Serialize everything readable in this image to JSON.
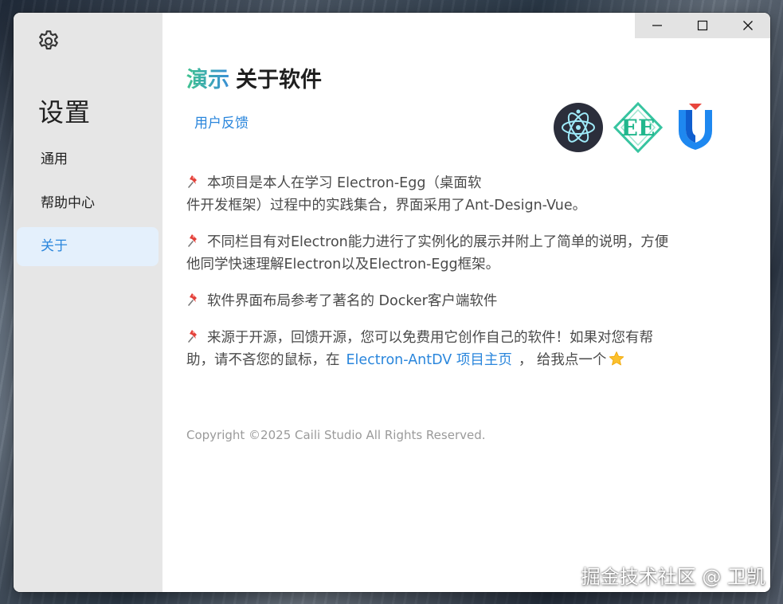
{
  "sidebar": {
    "title": "设置",
    "items": [
      {
        "label": "通用",
        "active": false
      },
      {
        "label": "帮助中心",
        "active": false
      },
      {
        "label": "关于",
        "active": true
      }
    ]
  },
  "page": {
    "title_accent": "演示",
    "title": "关于软件",
    "feedback_link": "用户反馈"
  },
  "content": {
    "p1_line1": "本项目是本人在学习 Electron-Egg（桌面软",
    "p1_line2": "件开发框架）过程中的实践集合，界面采用了Ant-Design-Vue。",
    "p2_line1": "不同栏目有对Electron能力进行了实例化的展示并附上了简单的说明，方便",
    "p2_line2": "他同学快速理解Electron以及Electron-Egg框架。",
    "p3": "软件界面布局参考了著名的 Docker客户端软件",
    "p4_line1": "来源于开源，回馈开源，您可以免费用它创作自己的软件！如果对您有帮",
    "p4_line2_prefix": "助，请不吝您的鼠标，在",
    "p4_link": "Electron-AntDV 项目主页",
    "p4_line2_suffix": "， 给我点一个"
  },
  "copyright": "Copyright ©2025 Caili Studio All Rights Reserved.",
  "watermark": "掘金技术社区 @ 卫凯",
  "icons": {
    "settings": "gear-icon",
    "minimize": "minimize-icon",
    "maximize": "maximize-icon",
    "close": "close-icon",
    "bullet": "pushpin-icon",
    "star": "star-icon",
    "logos": [
      "electron-logo",
      "electron-egg-logo",
      "antdv-logo"
    ]
  },
  "colors": {
    "accent": "#2a86dc",
    "sidebar_bg": "#e6e6e6",
    "active_bg": "#e4f0fc"
  }
}
